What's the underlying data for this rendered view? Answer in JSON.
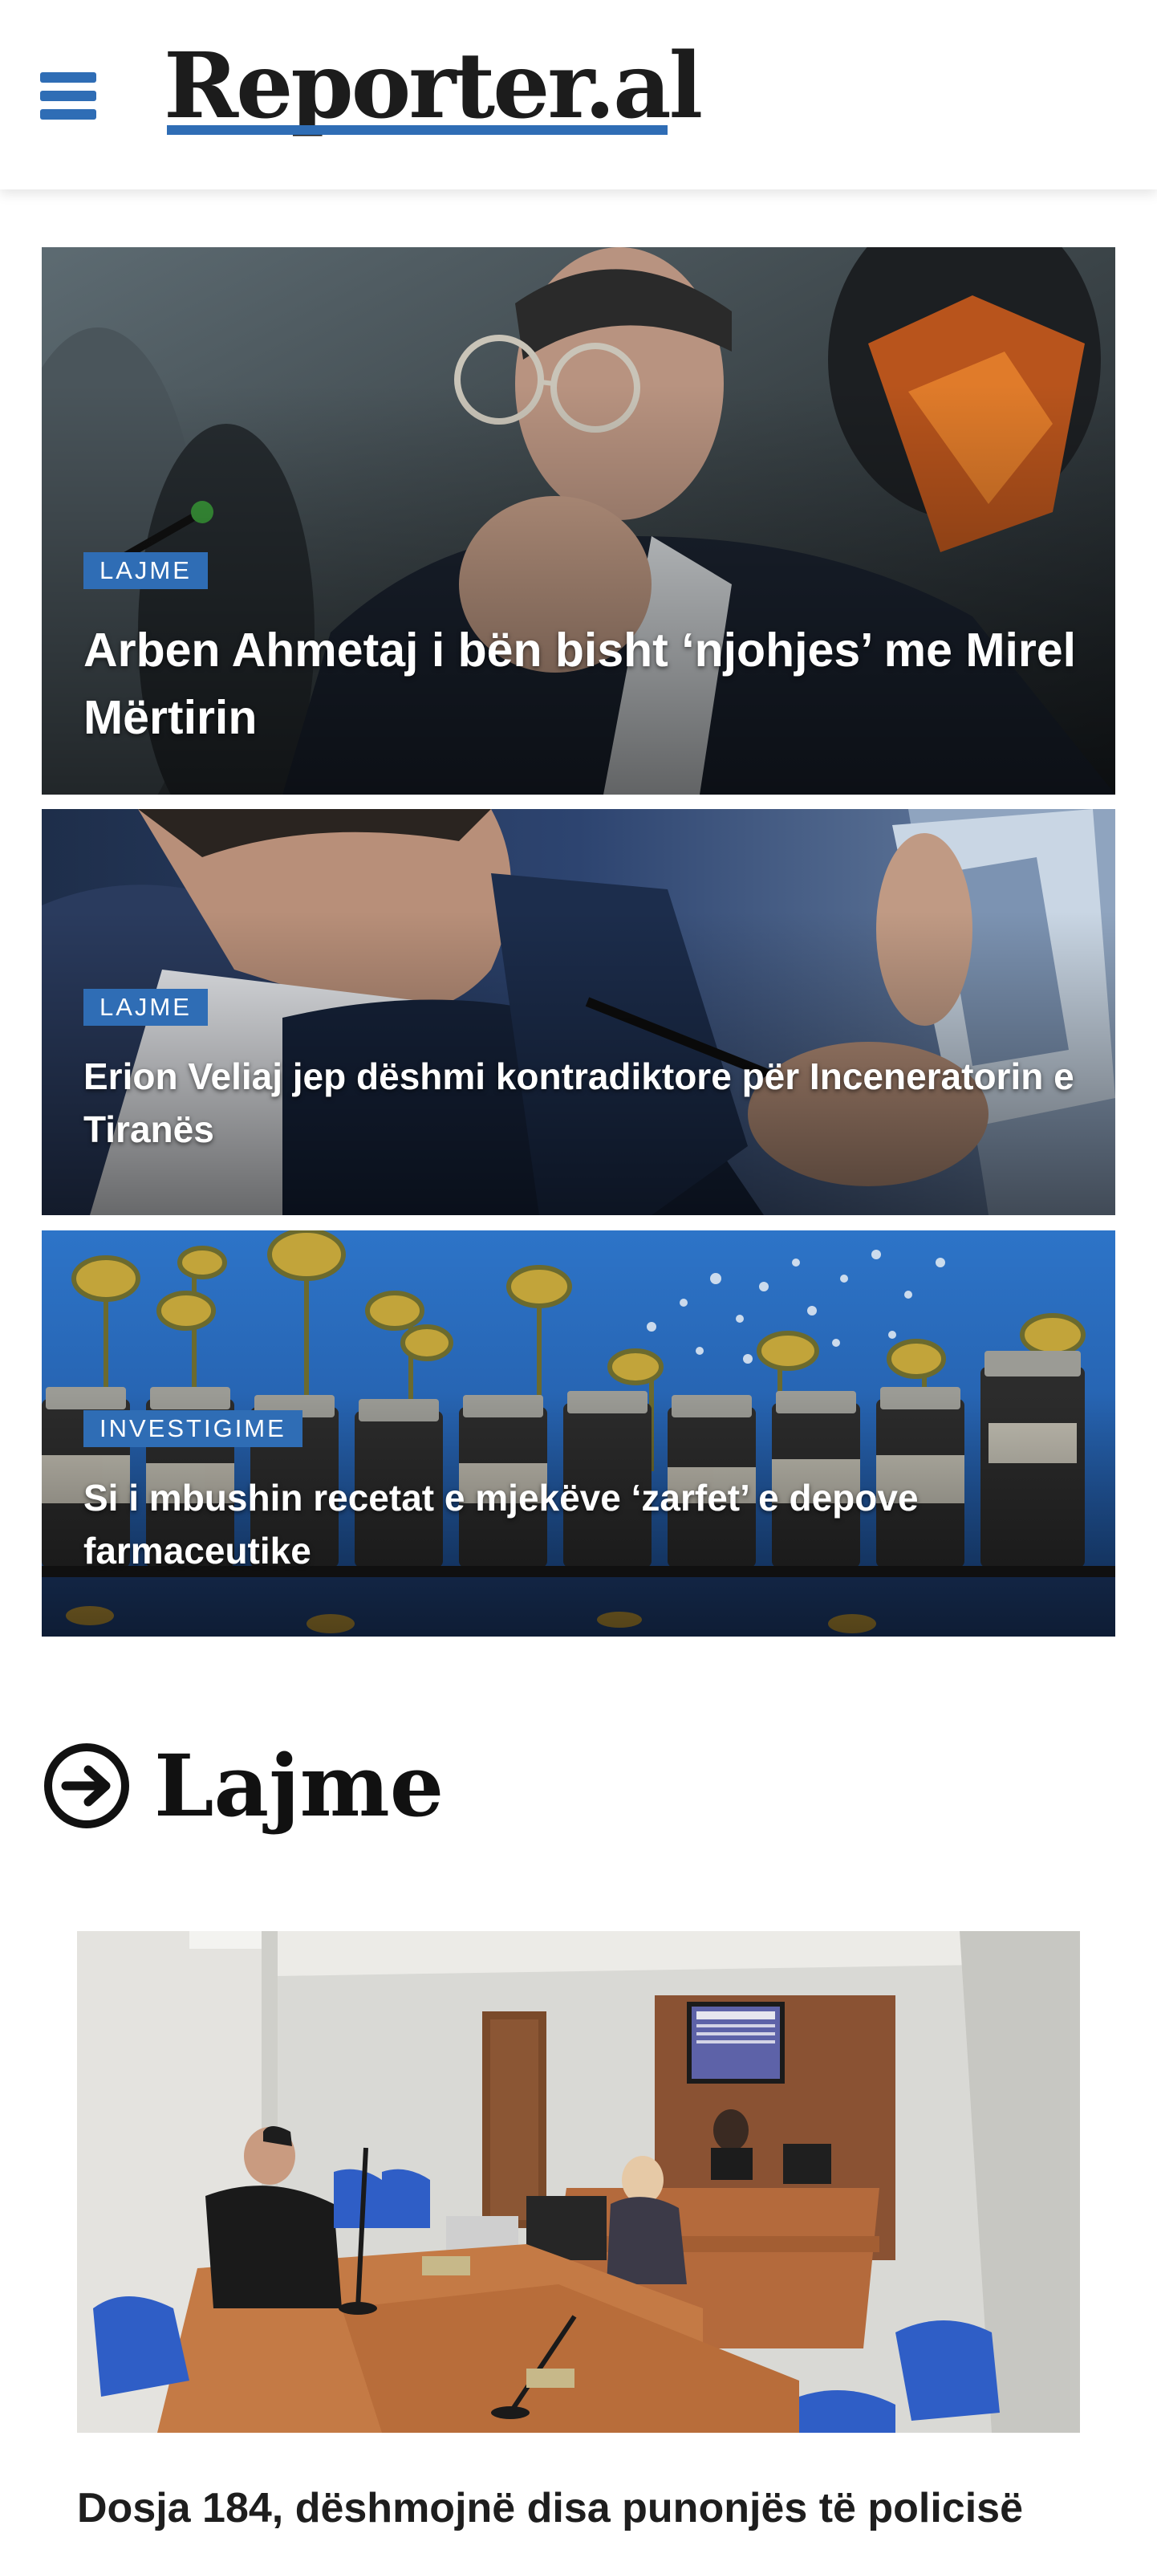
{
  "header": {
    "logo_text": "Reporter.al",
    "menu_icon": "hamburger-menu-icon",
    "brand_color": "#2f6db5"
  },
  "featured": [
    {
      "category": "LAJME",
      "title": "Arben Ahmetaj i bën bisht ‘njohjes’ me Mirel Mërtirin"
    },
    {
      "category": "LAJME",
      "title": "Erion Veliaj jep dëshmi kontradiktore për Inceneratorin e Tiranës"
    },
    {
      "category": "INVESTIGIME",
      "title": "Si i mbushin recetat e mjekëve ‘zarfet’ e depove farmaceutike"
    }
  ],
  "section": {
    "title": "Lajme",
    "icon": "arrow-circle-right-icon"
  },
  "article": {
    "title": "Dosja 184, dëshmojnë disa punonjës të policisë"
  }
}
